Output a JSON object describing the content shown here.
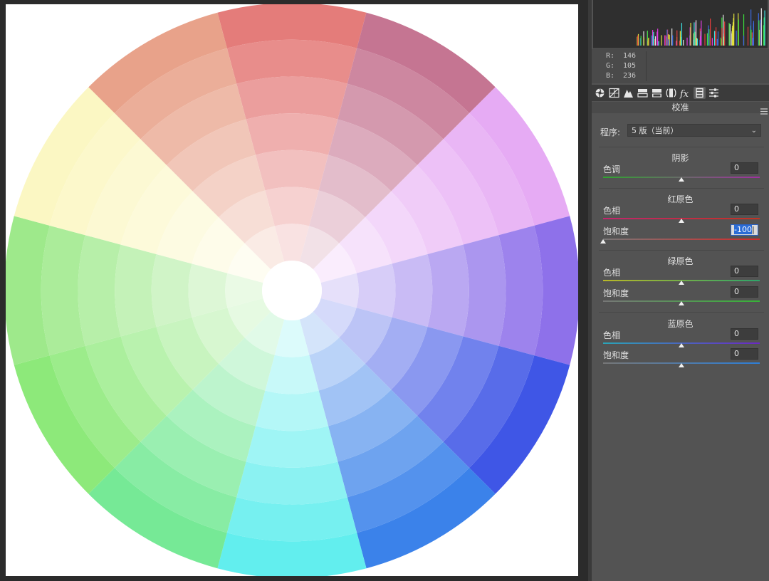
{
  "panel": {
    "title": "校准",
    "process_label": "程序:",
    "process_value": "5 版（当前）",
    "sections": [
      {
        "title": "阴影",
        "controls": [
          {
            "label": "色调",
            "value": "0",
            "level": 0.5,
            "gradient": [
              "#2fa52f",
              "#a22fa2"
            ]
          }
        ]
      },
      {
        "title": "红原色",
        "controls": [
          {
            "label": "色相",
            "value": "0",
            "level": 0.5,
            "gradient": [
              "#c2266e",
              "#c23322"
            ]
          },
          {
            "label": "饱和度",
            "value": "-100",
            "level": 0.0,
            "active": true,
            "gradient": [
              "#777777",
              "#d42a2a"
            ]
          }
        ]
      },
      {
        "title": "绿原色",
        "controls": [
          {
            "label": "色相",
            "value": "0",
            "level": 0.5,
            "gradient": [
              "#b9b828",
              "#2ea56a"
            ]
          },
          {
            "label": "饱和度",
            "value": "0",
            "level": 0.5,
            "gradient": [
              "#777777",
              "#37b437"
            ]
          }
        ]
      },
      {
        "title": "蓝原色",
        "controls": [
          {
            "label": "色相",
            "value": "0",
            "level": 0.5,
            "gradient": [
              "#2aa4b8",
              "#6b28c4"
            ]
          },
          {
            "label": "饱和度",
            "value": "0",
            "level": 0.5,
            "gradient": [
              "#777777",
              "#2d7fd8"
            ]
          }
        ]
      }
    ]
  },
  "readout": {
    "r_label": "R:",
    "r_value": "146",
    "g_label": "G:",
    "g_value": "105",
    "b_label": "B:",
    "b_value": "236"
  },
  "toolbar_icons": [
    "aperture-icon",
    "tone-curve-icon",
    "detail-icon",
    "hsl-icon",
    "split-toning-icon",
    "lens-correction-icon",
    "effects-fx-icon",
    "calibration-icon",
    "presets-icon"
  ],
  "colors": {
    "wheel_sectors": [
      "#e47c7a",
      "#c57592",
      "#e6abf4",
      "#8e71ea",
      "#3f56e6",
      "#3b82ea",
      "#62eeee",
      "#76e996",
      "#8de97a",
      "#9ee98b",
      "#fbf7c3",
      "#e8a28a"
    ],
    "panel_bg": "#535353",
    "canvas_bg": "#2b2b2b"
  }
}
